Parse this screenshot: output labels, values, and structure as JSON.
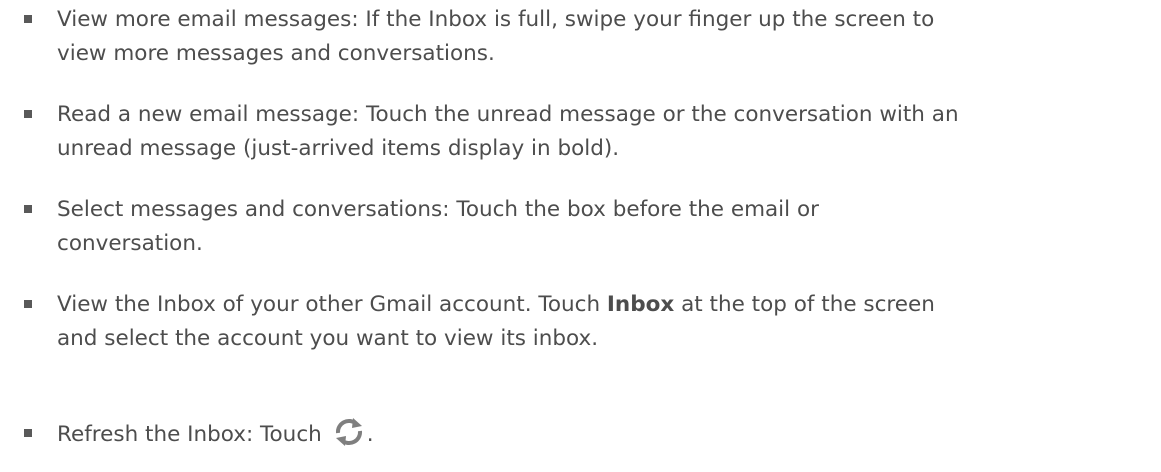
{
  "items": [
    {
      "line1": "View more email messages: If the Inbox is full, swipe your finger up the screen to",
      "line2": "view more messages and conversations."
    },
    {
      "line1": "Read a new email message: Touch the unread message or the conversation with an",
      "line2": "unread message (just-arrived items display in bold)."
    },
    {
      "line1": "Select messages and conversations: Touch the box before the email or",
      "line2": "conversation."
    },
    {
      "line1_before": "View the Inbox of your other Gmail account. Touch ",
      "line1_bold": "Inbox",
      "line1_after": " at the top of the screen",
      "line2": "and select the account you want to view its inbox."
    },
    {
      "text": "Refresh the Inbox: Touch",
      "icon": "refresh-icon",
      "suffix": "."
    }
  ],
  "colors": {
    "text": "#4d4d4d",
    "bullet": "#595959",
    "icon": "#7f7f7f"
  }
}
